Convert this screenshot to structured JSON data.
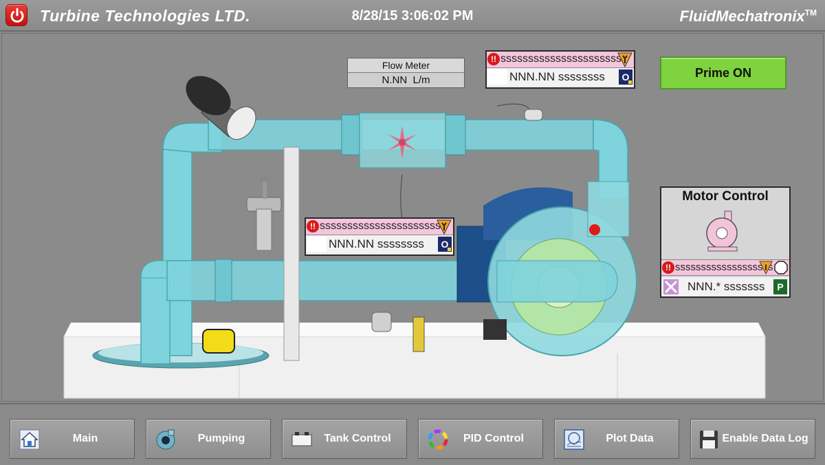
{
  "header": {
    "title": "Turbine Technologies LTD.",
    "datetime": "8/28/15 3:06:02 PM",
    "brand": "FluidMechatronix",
    "brand_mark": "TM",
    "power_icon": "power-icon"
  },
  "flow_meter": {
    "title": "Flow Meter",
    "value": "N.NN",
    "unit": "L/m"
  },
  "alarm_top": {
    "alarm_text": "sssssssssssssssssssssss",
    "value_text": "NNN.NN ssssssss",
    "mode": "O"
  },
  "alarm_mid": {
    "alarm_text": "sssssssssssssssssssssss",
    "value_text": "NNN.NN ssssssss",
    "mode": "O"
  },
  "prime": {
    "label": "Prime ON",
    "color": "#7ed33e"
  },
  "motor_control": {
    "title": "Motor Control",
    "alarm_text": "sssssssssssssssssss",
    "value_text": "NNN.* sssssss",
    "mode": "P"
  },
  "alarm_symbol": "!!",
  "nav": [
    {
      "label": "Main",
      "icon": "home-icon"
    },
    {
      "label": "Pumping",
      "icon": "pump-icon"
    },
    {
      "label": "Tank Control",
      "icon": "tank-icon"
    },
    {
      "label": "PID Control",
      "icon": "pid-wheel-icon"
    },
    {
      "label": "Plot Data",
      "icon": "plot-icon"
    },
    {
      "label": "Enable Data Log",
      "icon": "floppy-disk-icon"
    }
  ],
  "colors": {
    "background": "#8a8a8a",
    "pipe": "#7fd3dc",
    "alarm_banner": "#f4c6dd",
    "alarm_red": "#d81a1a",
    "prime_green": "#7ed33e"
  }
}
